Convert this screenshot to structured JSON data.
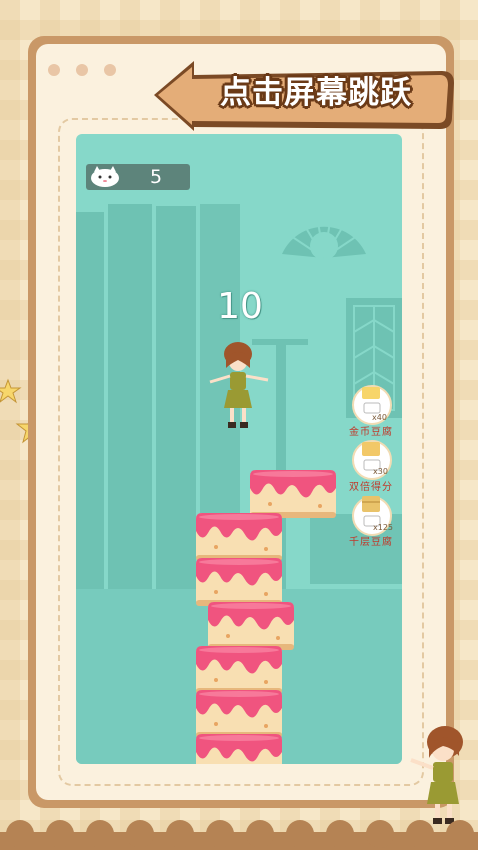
{
  "banner": {
    "text": "点击屏幕跳跃"
  },
  "hud": {
    "lives_icon": "cat-face-icon",
    "lives": "5",
    "score": "10"
  },
  "bonuses": [
    {
      "mult": "x40",
      "label": "金币豆腐",
      "icon": "gold-tofu-icon"
    },
    {
      "mult": "x30",
      "label": "双倍得分",
      "icon": "double-score-tofu-icon"
    },
    {
      "mult": "x125",
      "label": "千层豆腐",
      "icon": "layer-tofu-icon"
    }
  ],
  "colors": {
    "screen_bg": "#86d8c9",
    "cake_pink": "#f0547f",
    "cake_cream": "#f8dfb2",
    "frame": "#c99867"
  }
}
